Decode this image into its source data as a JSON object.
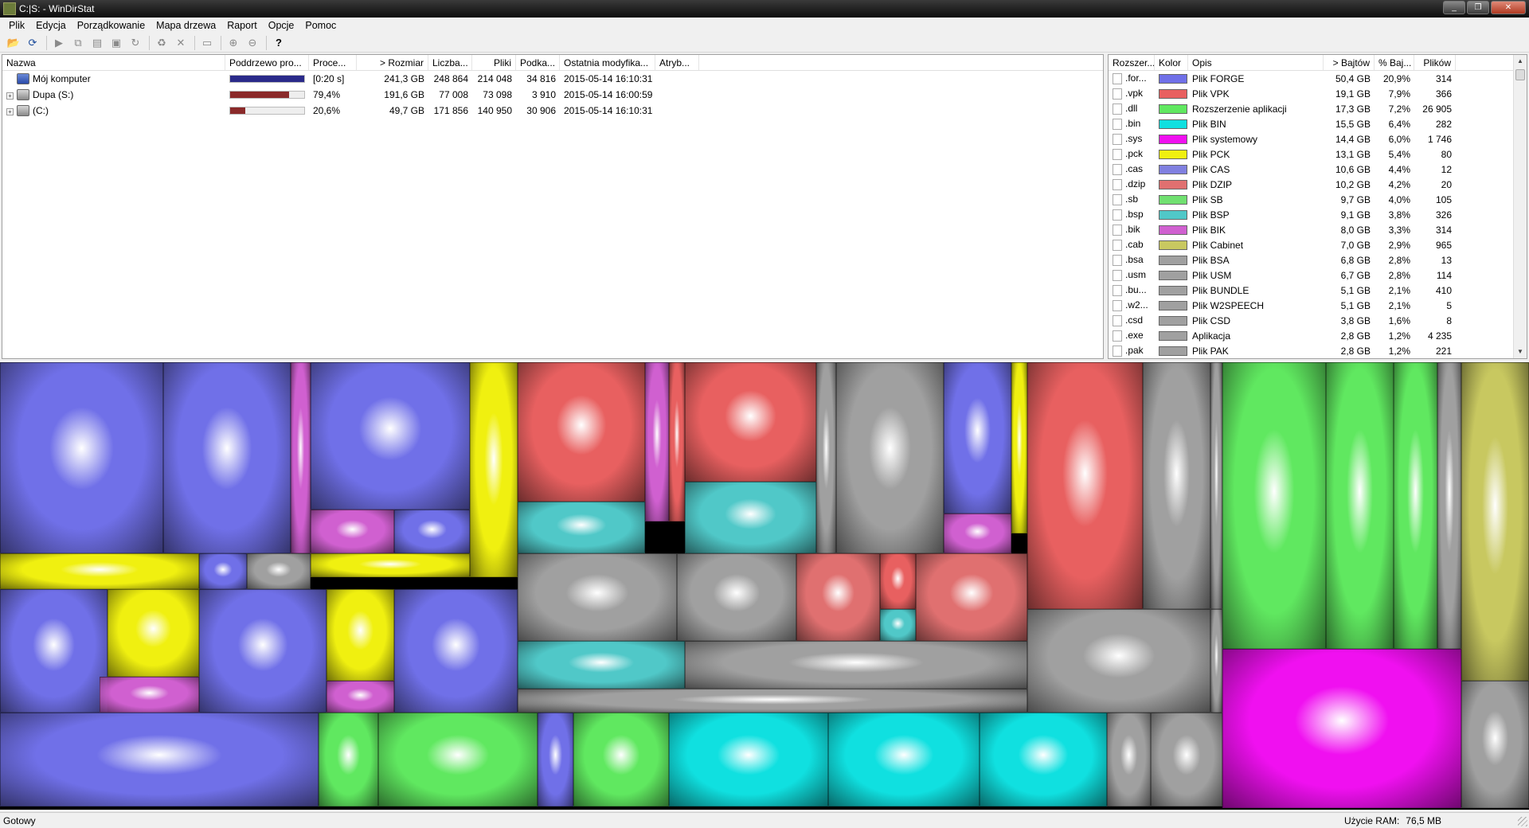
{
  "window": {
    "title": "C:|S: - WinDirStat",
    "buttons": [
      "_",
      "❐",
      "✕"
    ]
  },
  "menu": [
    "Plik",
    "Edycja",
    "Porządkowanie",
    "Mapa drzewa",
    "Raport",
    "Opcje",
    "Pomoc"
  ],
  "toolbar_icons": [
    "open-icon",
    "refresh-icon",
    "play-icon",
    "copy-icon",
    "paste-icon",
    "explorer-icon",
    "rerun-icon",
    "cleanup-icon",
    "delete-icon",
    "folder-icon",
    "zoom-in-icon",
    "zoom-out-icon",
    "help-icon"
  ],
  "tree": {
    "columns": [
      "Nazwa",
      "Poddrzewo pro...",
      "Proce...",
      "> Rozmiar",
      "Liczba...",
      "Pliki",
      "Podka...",
      "Ostatnia modyfika...",
      "Atryb..."
    ],
    "rows": [
      {
        "name": "Mój komputer",
        "bar_fraction": 1.0,
        "bar_color": "#2a2a8a",
        "percent": "[0:20 s]",
        "size": "241,3 GB",
        "items": "248 864",
        "files": "214 048",
        "subdirs": "34 816",
        "modified": "2015-05-14  16:10:31",
        "attr": "",
        "icon": "computer-icon",
        "expand": ""
      },
      {
        "name": "Dupa (S:)",
        "bar_fraction": 0.794,
        "bar_color": "#8a2a2a",
        "percent": "79,4%",
        "size": "191,6 GB",
        "items": "77 008",
        "files": "73 098",
        "subdirs": "3 910",
        "modified": "2015-05-14  16:00:59",
        "attr": "",
        "icon": "drive-icon",
        "expand": "+"
      },
      {
        "name": "(C:)",
        "bar_fraction": 0.206,
        "bar_color": "#8a2a2a",
        "percent": "20,6%",
        "size": "49,7 GB",
        "items": "171 856",
        "files": "140 950",
        "subdirs": "30 906",
        "modified": "2015-05-14  16:10:31",
        "attr": "",
        "icon": "system-drive-icon",
        "expand": "+"
      }
    ]
  },
  "extensions": {
    "columns": [
      "Rozszer...",
      "Kolor",
      "Opis",
      "> Bajtów",
      "% Baj...",
      "Plików"
    ],
    "rows": [
      {
        "ext": ".for...",
        "color": "#7070e8",
        "desc": "Plik FORGE",
        "bytes": "50,4 GB",
        "pct": "20,9%",
        "files": "314"
      },
      {
        "ext": ".vpk",
        "color": "#e86060",
        "desc": "Plik VPK",
        "bytes": "19,1 GB",
        "pct": "7,9%",
        "files": "366"
      },
      {
        "ext": ".dll",
        "color": "#60e860",
        "desc": "Rozszerzenie aplikacji",
        "bytes": "17,3 GB",
        "pct": "7,2%",
        "files": "26 905"
      },
      {
        "ext": ".bin",
        "color": "#10e0e0",
        "desc": "Plik BIN",
        "bytes": "15,5 GB",
        "pct": "6,4%",
        "files": "282"
      },
      {
        "ext": ".sys",
        "color": "#f010f0",
        "desc": "Plik systemowy",
        "bytes": "14,4 GB",
        "pct": "6,0%",
        "files": "1 746"
      },
      {
        "ext": ".pck",
        "color": "#f0f010",
        "desc": "Plik PCK",
        "bytes": "13,1 GB",
        "pct": "5,4%",
        "files": "80"
      },
      {
        "ext": ".cas",
        "color": "#8080e0",
        "desc": "Plik CAS",
        "bytes": "10,6 GB",
        "pct": "4,4%",
        "files": "12"
      },
      {
        "ext": ".dzip",
        "color": "#e07070",
        "desc": "Plik DZIP",
        "bytes": "10,2 GB",
        "pct": "4,2%",
        "files": "20"
      },
      {
        "ext": ".sb",
        "color": "#70e070",
        "desc": "Plik SB",
        "bytes": "9,7 GB",
        "pct": "4,0%",
        "files": "105"
      },
      {
        "ext": ".bsp",
        "color": "#50c8c8",
        "desc": "Plik BSP",
        "bytes": "9,1 GB",
        "pct": "3,8%",
        "files": "326"
      },
      {
        "ext": ".bik",
        "color": "#d060d0",
        "desc": "Plik BIK",
        "bytes": "8,0 GB",
        "pct": "3,3%",
        "files": "314"
      },
      {
        "ext": ".cab",
        "color": "#c8c860",
        "desc": "Plik Cabinet",
        "bytes": "7,0 GB",
        "pct": "2,9%",
        "files": "965"
      },
      {
        "ext": ".bsa",
        "color": "#a0a0a0",
        "desc": "Plik BSA",
        "bytes": "6,8 GB",
        "pct": "2,8%",
        "files": "13"
      },
      {
        "ext": ".usm",
        "color": "#a0a0a0",
        "desc": "Plik USM",
        "bytes": "6,7 GB",
        "pct": "2,8%",
        "files": "114"
      },
      {
        "ext": ".bu...",
        "color": "#a0a0a0",
        "desc": "Plik BUNDLE",
        "bytes": "5,1 GB",
        "pct": "2,1%",
        "files": "410"
      },
      {
        "ext": ".w2...",
        "color": "#a0a0a0",
        "desc": "Plik W2SPEECH",
        "bytes": "5,1 GB",
        "pct": "2,1%",
        "files": "5"
      },
      {
        "ext": ".csd",
        "color": "#a0a0a0",
        "desc": "Plik CSD",
        "bytes": "3,8 GB",
        "pct": "1,6%",
        "files": "8"
      },
      {
        "ext": ".exe",
        "color": "#a0a0a0",
        "desc": "Aplikacja",
        "bytes": "2,8 GB",
        "pct": "1,2%",
        "files": "4 235"
      },
      {
        "ext": ".pak",
        "color": "#a0a0a0",
        "desc": "Plik PAK",
        "bytes": "2,8 GB",
        "pct": "1,2%",
        "files": "221"
      }
    ]
  },
  "status": {
    "left": "Gotowy",
    "ram_label": "Użycie RAM:",
    "ram_value": "76,5 MB"
  }
}
